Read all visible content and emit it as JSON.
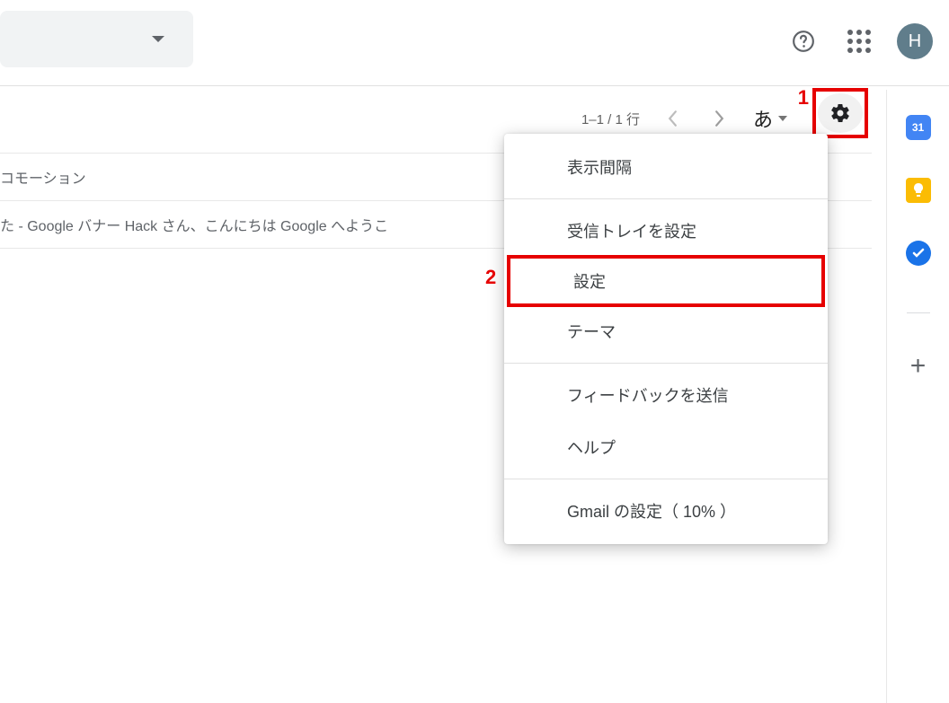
{
  "header": {
    "avatar_initial": "H"
  },
  "toolbar": {
    "paging": "1–1 / 1 行",
    "ime_label": "あ"
  },
  "rows": {
    "r1": "コモーション",
    "r2": "た - Google バナー Hack さん、こんにちは Google へようこ"
  },
  "menu": {
    "density": "表示間隔",
    "inbox_config": "受信トレイを設定",
    "settings": "設定",
    "themes": "テーマ",
    "feedback": "フィードバックを送信",
    "help": "ヘルプ",
    "gmail_setup": "Gmail の設定（ 10% ）"
  },
  "side": {
    "calendar_day": "31"
  },
  "annotations": {
    "a1": "1",
    "a2": "2"
  }
}
